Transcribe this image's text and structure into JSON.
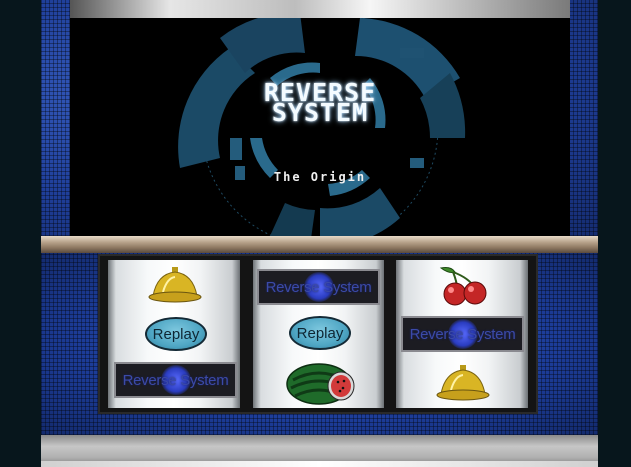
{
  "game": {
    "title_line1": "REVERSE",
    "title_line2": "SYSTEM",
    "subtitle": "The Origin"
  },
  "reels": [
    {
      "id": "reel-1",
      "symbols": [
        {
          "type": "bell"
        },
        {
          "type": "replay",
          "label": "Replay"
        },
        {
          "type": "reverse-system",
          "label": "Reverse System"
        }
      ]
    },
    {
      "id": "reel-2",
      "symbols": [
        {
          "type": "reverse-system",
          "label": "Reverse System"
        },
        {
          "type": "replay",
          "label": "Replay"
        },
        {
          "type": "watermelon"
        }
      ]
    },
    {
      "id": "reel-3",
      "symbols": [
        {
          "type": "cherry"
        },
        {
          "type": "reverse-system",
          "label": "Reverse System"
        },
        {
          "type": "bell"
        }
      ]
    }
  ],
  "colors": {
    "cabinet_blue": "#1f3f9a",
    "title_glow": "#9fd3ff",
    "replay_blue": "#4fa6c4",
    "reverse_system_text": "#3b4aa8"
  }
}
